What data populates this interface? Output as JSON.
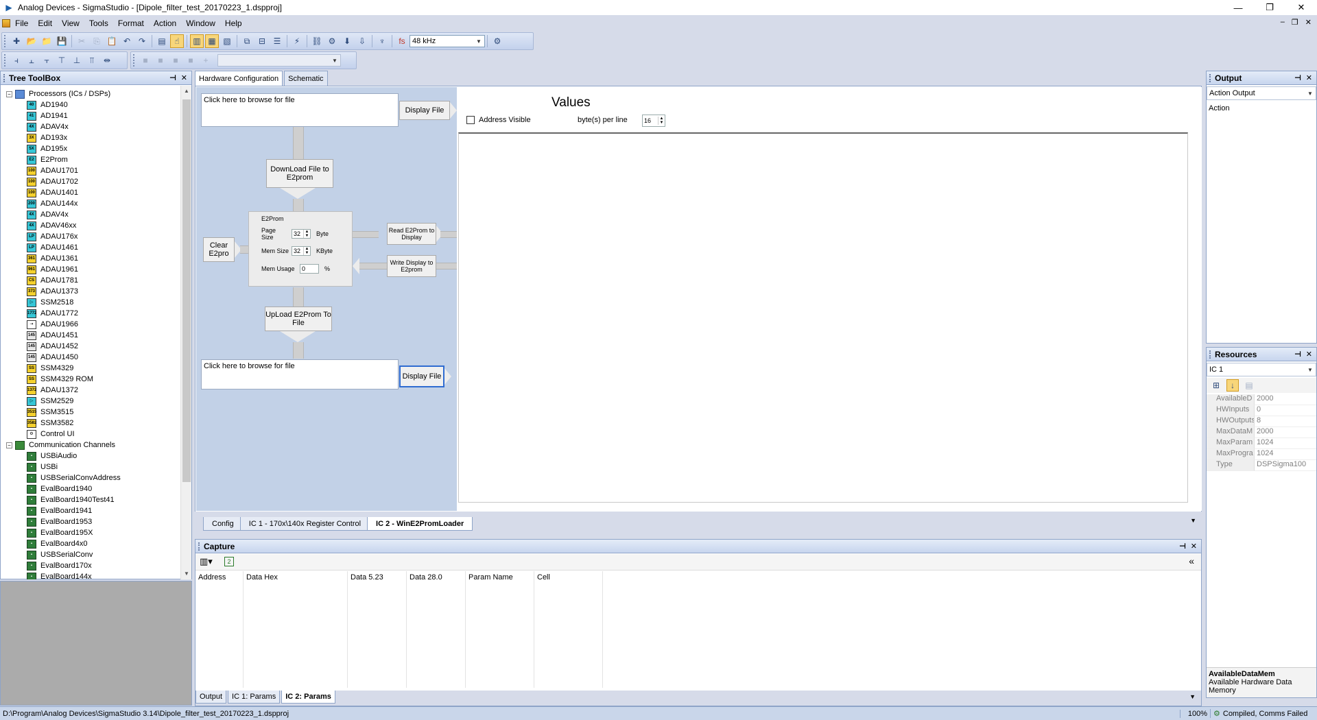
{
  "window": {
    "title": "Analog Devices - SigmaStudio - [Dipole_filter_test_20170223_1.dspproj]",
    "min": "—",
    "restore": "❐",
    "close": "✕"
  },
  "menu": [
    "File",
    "Edit",
    "View",
    "Tools",
    "Format",
    "Action",
    "Window",
    "Help"
  ],
  "mdi_controls": [
    "–",
    "❐",
    "✕"
  ],
  "toolbar": {
    "sample_rate": "48 kHz"
  },
  "tree": {
    "title": "Tree ToolBox",
    "pin": "⊣",
    "close": "✕",
    "processors_label": "Processors (ICs / DSPs)",
    "processors": [
      {
        "name": "AD1940",
        "badge": "40",
        "color": "#36c6d6"
      },
      {
        "name": "AD1941",
        "badge": "41",
        "color": "#36c6d6"
      },
      {
        "name": "ADAV4x",
        "badge": "4X",
        "color": "#36c6d6"
      },
      {
        "name": "AD193x",
        "badge": "3X",
        "color": "#f5d12e"
      },
      {
        "name": "AD195x",
        "badge": "5X",
        "color": "#36c6d6"
      },
      {
        "name": "E2Prom",
        "badge": "E2",
        "color": "#36c6d6"
      },
      {
        "name": "ADAU1701",
        "badge": "100",
        "color": "#f5d12e"
      },
      {
        "name": "ADAU1702",
        "badge": "100",
        "color": "#f5d12e"
      },
      {
        "name": "ADAU1401",
        "badge": "100",
        "color": "#f5d12e"
      },
      {
        "name": "ADAU144x",
        "badge": "200",
        "color": "#36c6d6"
      },
      {
        "name": "ADAV4x",
        "badge": "4X",
        "color": "#36c6d6"
      },
      {
        "name": "ADAV46xx",
        "badge": "4X",
        "color": "#36c6d6"
      },
      {
        "name": "ADAU176x",
        "badge": "LP",
        "color": "#36c6d6"
      },
      {
        "name": "ADAU1461",
        "badge": "LP",
        "color": "#36c6d6"
      },
      {
        "name": "ADAU1361",
        "badge": "361",
        "color": "#f5d12e"
      },
      {
        "name": "ADAU1961",
        "badge": "961",
        "color": "#f5d12e"
      },
      {
        "name": "ADAU1781",
        "badge": "CS",
        "color": "#f5d12e"
      },
      {
        "name": "ADAU1373",
        "badge": "373",
        "color": "#f5d12e"
      },
      {
        "name": "SSM2518",
        "badge": "▷",
        "color": "#36c6d6"
      },
      {
        "name": "ADAU1772",
        "badge": "1772",
        "color": "#36c6d6"
      },
      {
        "name": "ADAU1966",
        "badge": "⇢",
        "color": "#ffffff"
      },
      {
        "name": "ADAU1451",
        "badge": "145",
        "color": "#e6e6e6"
      },
      {
        "name": "ADAU1452",
        "badge": "145",
        "color": "#e6e6e6"
      },
      {
        "name": "ADAU1450",
        "badge": "145",
        "color": "#e6e6e6"
      },
      {
        "name": "SSM4329",
        "badge": "SS",
        "color": "#f5d12e"
      },
      {
        "name": "SSM4329 ROM",
        "badge": "SS",
        "color": "#f5d12e"
      },
      {
        "name": "ADAU1372",
        "badge": "1372",
        "color": "#f5d12e"
      },
      {
        "name": "SSM2529",
        "badge": "▷",
        "color": "#36c6d6"
      },
      {
        "name": "SSM3515",
        "badge": "3515",
        "color": "#f5d12e"
      },
      {
        "name": "SSM3582",
        "badge": "3582",
        "color": "#f5d12e"
      },
      {
        "name": "Control UI",
        "badge": "⚙",
        "color": "#ffffff"
      }
    ],
    "channels_label": "Communication Channels",
    "channels": [
      "USBiAudio",
      "USBi",
      "USBSerialConvAddress",
      "EvalBoard1940",
      "EvalBoard1940Test41",
      "EvalBoard1941",
      "EvalBoard1953",
      "EvalBoard195X",
      "EvalBoard4x0",
      "USBSerialConv",
      "EvalBoard170x",
      "EvalBoard144x"
    ]
  },
  "doc_tabs": [
    "Hardware Configuration",
    "Schematic"
  ],
  "loader": {
    "browse_top": "Click here to browse for file",
    "display_file_top": "Display File",
    "download_btn": "DownLoad File to E2prom",
    "clear_btn": "Clear E2pro",
    "e2prom_group": "E2Prom",
    "page_size_label": "Page Size",
    "page_size_value": "32",
    "page_size_unit": "Byte",
    "mem_size_label": "Mem Size",
    "mem_size_value": "32",
    "mem_size_unit": "KByte",
    "mem_usage_label": "Mem Usage",
    "mem_usage_value": "0",
    "mem_usage_unit": "%",
    "read_btn": "Read E2Prom to Display",
    "write_btn": "Write Display to E2prom",
    "upload_btn": "UpLoad E2Prom To File",
    "browse_bottom": "Click here to browse for file",
    "display_file_bottom": "Display File"
  },
  "values": {
    "title": "Values",
    "address_visible": "Address Visible",
    "bytes_per_line_label": "byte(s) per line",
    "bytes_per_line_value": "16"
  },
  "bottom_tabs": [
    "Config",
    "IC 1 - 170x\\140x Register Control",
    "IC 2 - WinE2PromLoader"
  ],
  "capture": {
    "title": "Capture",
    "columns": [
      "Address",
      "Data Hex",
      "Data 5.23",
      "Data 28.0",
      "Param Name",
      "Cell"
    ],
    "tabs": [
      "Output",
      "IC 1: Params",
      "IC 2: Params"
    ]
  },
  "output": {
    "title": "Output",
    "combo": "Action Output",
    "action_label": "Action"
  },
  "resources": {
    "title": "Resources",
    "combo": "IC 1",
    "properties": [
      {
        "key": "AvailableD",
        "value": "2000"
      },
      {
        "key": "HWInputs",
        "value": "0"
      },
      {
        "key": "HWOutputs",
        "value": "8"
      },
      {
        "key": "MaxDataM",
        "value": "2000"
      },
      {
        "key": "MaxParam",
        "value": "1024"
      },
      {
        "key": "MaxProgra",
        "value": "1024"
      },
      {
        "key": "Type",
        "value": "DSPSigma100"
      }
    ],
    "desc_title": "AvailableDataMem",
    "desc_text": "Available Hardware Data Memory"
  },
  "status": {
    "path": "D:\\Program\\Analog Devices\\SigmaStudio 3.14\\Dipole_filter_test_20170223_1.dspproj",
    "zoom": "100%",
    "state": "Compiled, Comms Failed"
  }
}
